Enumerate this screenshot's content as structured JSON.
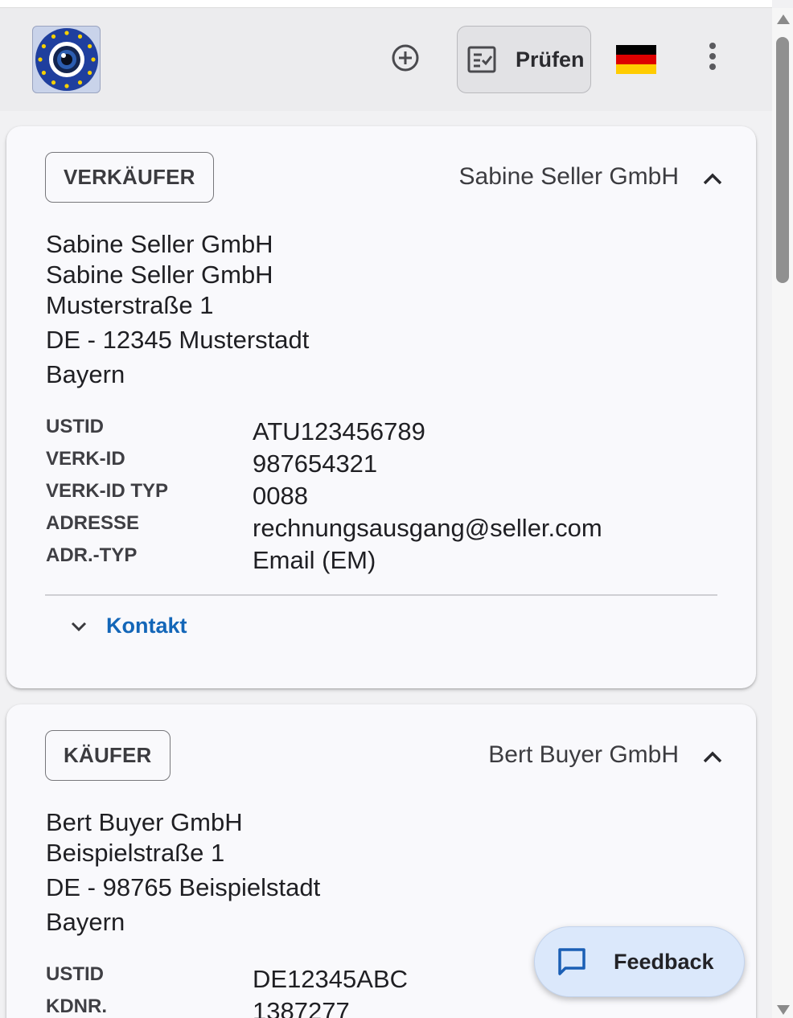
{
  "toolbar": {
    "logo_icon": "eu-eye-logo-icon",
    "add_icon": "add-circle-icon",
    "check_icon": "checklist-icon",
    "check_label": "Prüfen",
    "language_flag": "german-flag-icon",
    "flag_colors": [
      "#000000",
      "#dd0000",
      "#ffcc00"
    ],
    "menu_icon": "more-vertical-icon"
  },
  "seller": {
    "role": "VERKÄUFER",
    "name": "Sabine Seller GmbH",
    "address_lines": [
      "Sabine Seller GmbH",
      "Sabine Seller GmbH",
      "Musterstraße 1",
      "DE - 12345 Musterstadt",
      "Bayern"
    ],
    "fields": [
      {
        "key": "USTID",
        "value": "ATU123456789"
      },
      {
        "key": "VERK-ID",
        "value": "987654321"
      },
      {
        "key": "VERK-ID TYP",
        "value": "0088"
      },
      {
        "key": "ADRESSE",
        "value": "rechnungsausgang@seller.com"
      },
      {
        "key": "ADR.-TYP",
        "value": "Email (EM)"
      }
    ],
    "contact_label": "Kontakt"
  },
  "buyer": {
    "role": "KÄUFER",
    "name": "Bert Buyer GmbH",
    "address_lines": [
      "Bert Buyer GmbH",
      "Beispielstraße 1",
      "DE - 98765 Beispielstadt",
      "Bayern"
    ],
    "fields": [
      {
        "key": "USTID",
        "value": "DE12345ABC"
      },
      {
        "key": "KDNR.",
        "value": "1387277"
      }
    ]
  },
  "feedback": {
    "icon": "chat-bubble-icon",
    "label": "Feedback"
  },
  "colors": {
    "link": "#1366b8",
    "card": "#f9f9fc",
    "toolbar": "#ececee",
    "feedback_bg": "#dbe8fb"
  }
}
